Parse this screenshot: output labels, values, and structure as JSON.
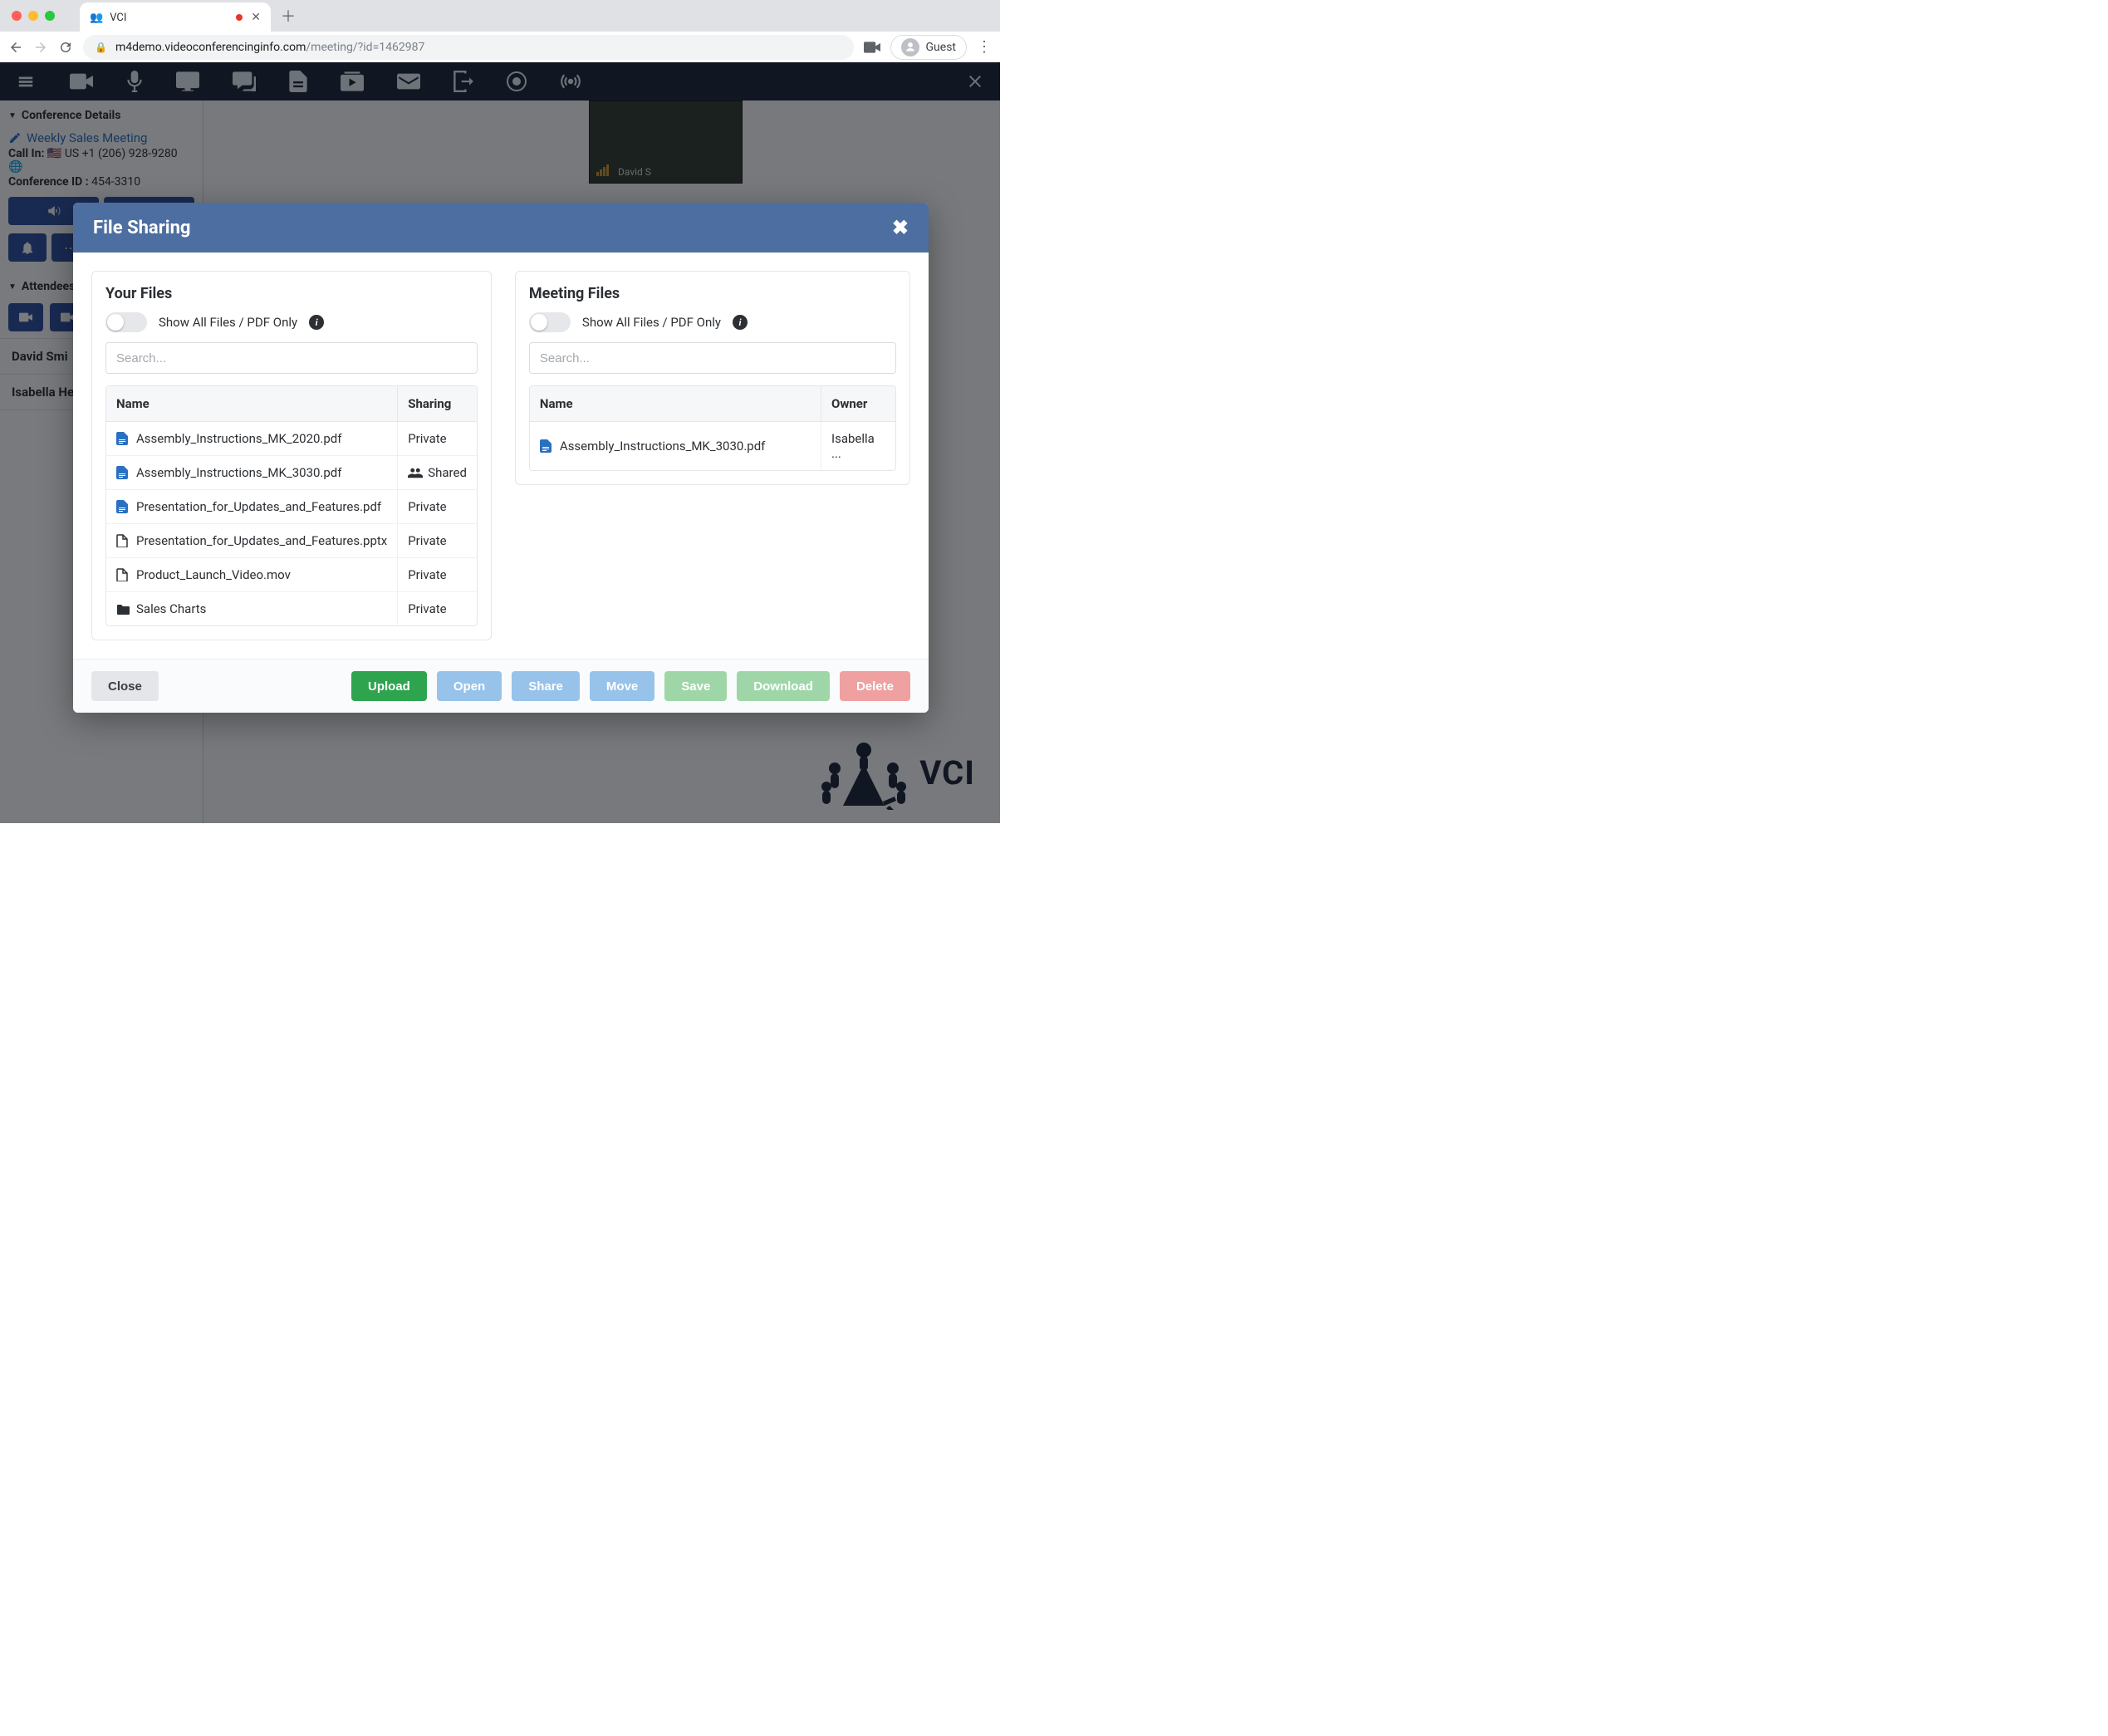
{
  "browser": {
    "tab_title": "VCI",
    "guest_label": "Guest",
    "url_host": "m4demo.videoconferencinginfo.com",
    "url_path": "/meeting/?id=1462987"
  },
  "sidebar": {
    "conf_details_label": "Conference Details",
    "meeting_title": "Weekly Sales Meeting",
    "callin_label": "Call In:",
    "callin_value": "US +1 (206) 928-9280",
    "confid_label": "Conference ID :",
    "confid_value": "454-3310",
    "attendees_label": "Attendees",
    "attendees": [
      "David Smi",
      "Isabella He"
    ]
  },
  "video": {
    "name_overlay": "David S"
  },
  "logo": {
    "text": "VCI"
  },
  "modal": {
    "title": "File Sharing",
    "left": {
      "title": "Your Files",
      "toggle_label": "Show All Files / PDF Only",
      "search_placeholder": "Search...",
      "columns": [
        "Name",
        "Sharing"
      ],
      "rows": [
        {
          "icon": "pdf",
          "name": "Assembly_Instructions_MK_2020.pdf",
          "sharing": "Private",
          "shared": false
        },
        {
          "icon": "pdf",
          "name": "Assembly_Instructions_MK_3030.pdf",
          "sharing": "Shared",
          "shared": true
        },
        {
          "icon": "pdf",
          "name": "Presentation_for_Updates_and_Features.pdf",
          "sharing": "Private",
          "shared": false
        },
        {
          "icon": "file",
          "name": "Presentation_for_Updates_and_Features.pptx",
          "sharing": "Private",
          "shared": false
        },
        {
          "icon": "file",
          "name": "Product_Launch_Video.mov",
          "sharing": "Private",
          "shared": false
        },
        {
          "icon": "folder",
          "name": "Sales Charts",
          "sharing": "Private",
          "shared": false
        }
      ]
    },
    "right": {
      "title": "Meeting Files",
      "toggle_label": "Show All Files / PDF Only",
      "search_placeholder": "Search...",
      "columns": [
        "Name",
        "Owner"
      ],
      "rows": [
        {
          "icon": "pdf",
          "name": "Assembly_Instructions_MK_3030.pdf",
          "owner": "Isabella ..."
        }
      ]
    },
    "buttons": {
      "close": "Close",
      "upload": "Upload",
      "open": "Open",
      "share": "Share",
      "move": "Move",
      "save": "Save",
      "download": "Download",
      "delete": "Delete"
    }
  }
}
